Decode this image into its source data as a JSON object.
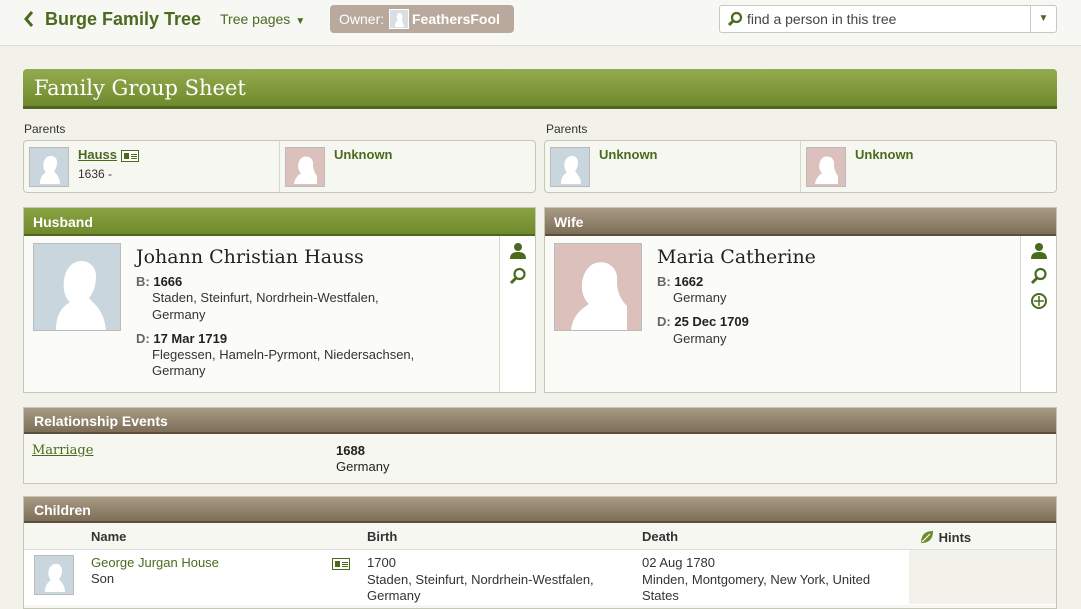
{
  "header": {
    "title": "Burge Family Tree",
    "tree_pages": "Tree pages",
    "owner_label": "Owner:",
    "owner_name": "FeathersFool",
    "search_placeholder": "find a person in this tree"
  },
  "sheet": {
    "title": "Family Group Sheet"
  },
  "husband_parents": {
    "label": "Parents",
    "father": {
      "name": "Hauss",
      "dates": "1636 -"
    },
    "mother": {
      "name": "Unknown"
    }
  },
  "wife_parents": {
    "label": "Parents",
    "father": {
      "name": "Unknown"
    },
    "mother": {
      "name": "Unknown"
    }
  },
  "husband": {
    "panel_label": "Husband",
    "name": "Johann Christian Hauss",
    "birth_label": "B:",
    "birth_date": "1666",
    "birth_place_1": "Staden, Steinfurt, Nordrhein-Westfalen,",
    "birth_place_2": "Germany",
    "death_label": "D:",
    "death_date": "17 Mar 1719",
    "death_place_1": "Flegessen, Hameln-Pyrmont, Niedersachsen,",
    "death_place_2": "Germany"
  },
  "wife": {
    "panel_label": "Wife",
    "name": "Maria Catherine",
    "birth_label": "B:",
    "birth_date": "1662",
    "birth_place_1": "Germany",
    "death_label": "D:",
    "death_date": "25 Dec 1709",
    "death_place_1": "Germany"
  },
  "relationship": {
    "title": "Relationship Events",
    "event": "Marriage",
    "date": "1688",
    "place": "Germany"
  },
  "children": {
    "title": "Children",
    "columns": {
      "name": "Name",
      "birth": "Birth",
      "death": "Death",
      "hints": "Hints"
    },
    "rows": [
      {
        "name": "George Jurgan House",
        "relation": "Son",
        "birth_date": "1700",
        "birth_place_1": "Staden, Steinfurt, Nordrhein-Westfalen,",
        "birth_place_2": "Germany",
        "death_date": "02 Aug 1780",
        "death_place_1": "Minden, Montgomery, New York, United",
        "death_place_2": "States"
      }
    ]
  },
  "colors": {
    "accent_green": "#4a6b1e",
    "header_brown": "#7d6e57",
    "header_green": "#6f8a2c"
  }
}
